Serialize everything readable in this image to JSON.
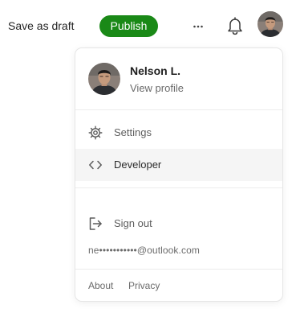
{
  "topbar": {
    "save_draft_label": "Save as draft",
    "publish_label": "Publish",
    "more_icon": "more-icon",
    "bell_icon": "bell-icon"
  },
  "menu": {
    "profile": {
      "name": "Nelson L.",
      "link": "View profile"
    },
    "items": [
      {
        "label": "Settings",
        "icon": "gear-icon"
      },
      {
        "label": "Developer",
        "icon": "code-icon"
      }
    ],
    "sign_out": {
      "label": "Sign out",
      "icon": "sign-out-icon"
    },
    "email": "ne•••••••••••@outlook.com",
    "footer": [
      {
        "label": "About"
      },
      {
        "label": "Privacy"
      }
    ]
  },
  "colors": {
    "publish_green": "#1a8917",
    "active_row": "#f5f5f5"
  }
}
